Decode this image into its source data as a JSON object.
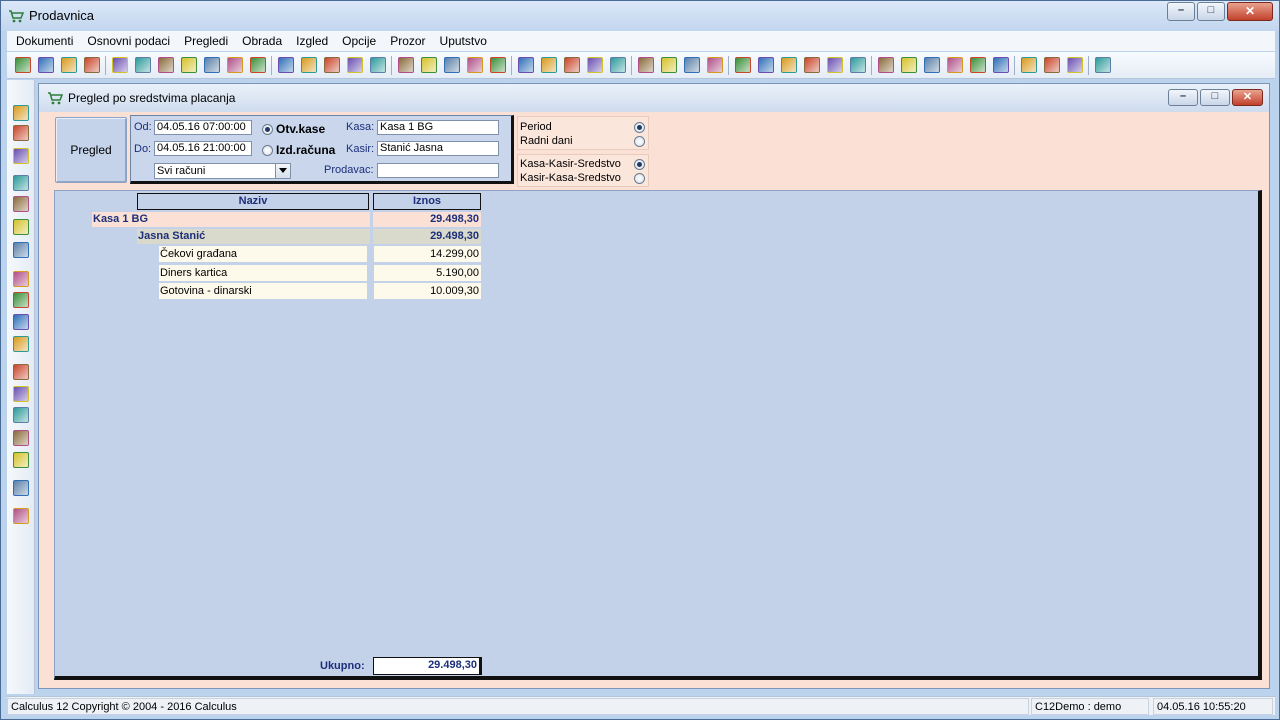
{
  "app": {
    "title": "Prodavnica",
    "window_buttons": {
      "minimize": "–",
      "maximize": "□",
      "close": "✕"
    }
  },
  "menu": [
    "Dokumenti",
    "Osnovni podaci",
    "Pregledi",
    "Obrada",
    "Izgled",
    "Opcije",
    "Prozor",
    "Uputstvo"
  ],
  "toolbar": {
    "icons": [
      "new-document-icon",
      "refresh-icon",
      "recycle-icon",
      "export-icon",
      "save-icon",
      "import-icon",
      "forward-icon",
      "document-icon",
      "minus-icon",
      "add-icon",
      "folder-up-icon",
      "folder-down-icon",
      "list-icon",
      "chart-icon",
      "package-icon",
      "mail-icon",
      "pen-icon",
      "edit-icon",
      "attach-icon",
      "calendar-icon",
      "screen-icon",
      "forward-screen-icon",
      "money-icon",
      "bars-chart-icon",
      "clipboard-icon",
      "sum-icon",
      "grid-icon",
      "report-icon",
      "columns-icon",
      "table-icon",
      "tree-icon",
      "copy-icon",
      "fill-icon",
      "move-icon",
      "back-icon",
      "bulb-icon",
      "tag-icon",
      "gear-icon",
      "book-icon",
      "heart-icon",
      "print-icon",
      "stamp-icon",
      "info-icon",
      "layout-icon",
      "help-icon",
      "exit-icon"
    ]
  },
  "sidebar_tools": [
    "save-icon",
    "table-icon",
    "table-edit-icon",
    "print-icon",
    "print-preview-icon",
    "export-excel-icon",
    "word-icon",
    "add-circle-icon",
    "remove-circle-icon",
    "undo-icon",
    "edit-icon",
    "find-icon",
    "find-next-icon",
    "sort-icon",
    "filter-icon",
    "expand-icon",
    "help-icon",
    "go-icon"
  ],
  "child": {
    "title": "Pregled po sredstvima placanja",
    "window_buttons": {
      "minimize": "–",
      "maximize": "□",
      "close": "✕"
    }
  },
  "filters": {
    "pregled_button": "Pregled",
    "od_label": "Od:",
    "od_value": "04.05.16 07:00:00",
    "do_label": "Do:",
    "do_value": "04.05.16 21:00:00",
    "radio_otv": "Otv.kase",
    "radio_izd": "Izd.računa",
    "racuni_dropdown": "Svi računi",
    "kasa_label": "Kasa:",
    "kasa_value": "Kasa 1 BG",
    "kasir_label": "Kasir:",
    "kasir_value": "Stanić Jasna",
    "prodavac_label": "Prodavac:",
    "prodavac_value": "",
    "period_label": "Period",
    "radni_dani_label": "Radni dani",
    "order1_label": "Kasa-Kasir-Sredstvo",
    "order2_label": "Kasir-Kasa-Sredstvo"
  },
  "table": {
    "headers": {
      "naziv": "Naziv",
      "iznos": "Iznos"
    },
    "kasa": {
      "name": "Kasa 1 BG",
      "amount": "29.498,30"
    },
    "kasir": {
      "name": "Jasna Stanić",
      "amount": "29.498,30"
    },
    "rows": [
      {
        "name": "Čekovi građana",
        "amount": "14.299,00"
      },
      {
        "name": "Diners kartica",
        "amount": "5.190,00"
      },
      {
        "name": "Gotovina - dinarski",
        "amount": "10.009,30"
      }
    ],
    "total_label": "Ukupno:",
    "total_value": "29.498,30"
  },
  "status": {
    "copyright": "Calculus 12  Copyright © 2004 - 2016  Calculus",
    "user": "C12Demo : demo",
    "datetime": "04.05.16 10:55:20"
  },
  "colors": {
    "accent_blue": "#1d2f7a",
    "panel_blue": "#c3d1e9",
    "pink_bg": "#fbe1d5"
  }
}
